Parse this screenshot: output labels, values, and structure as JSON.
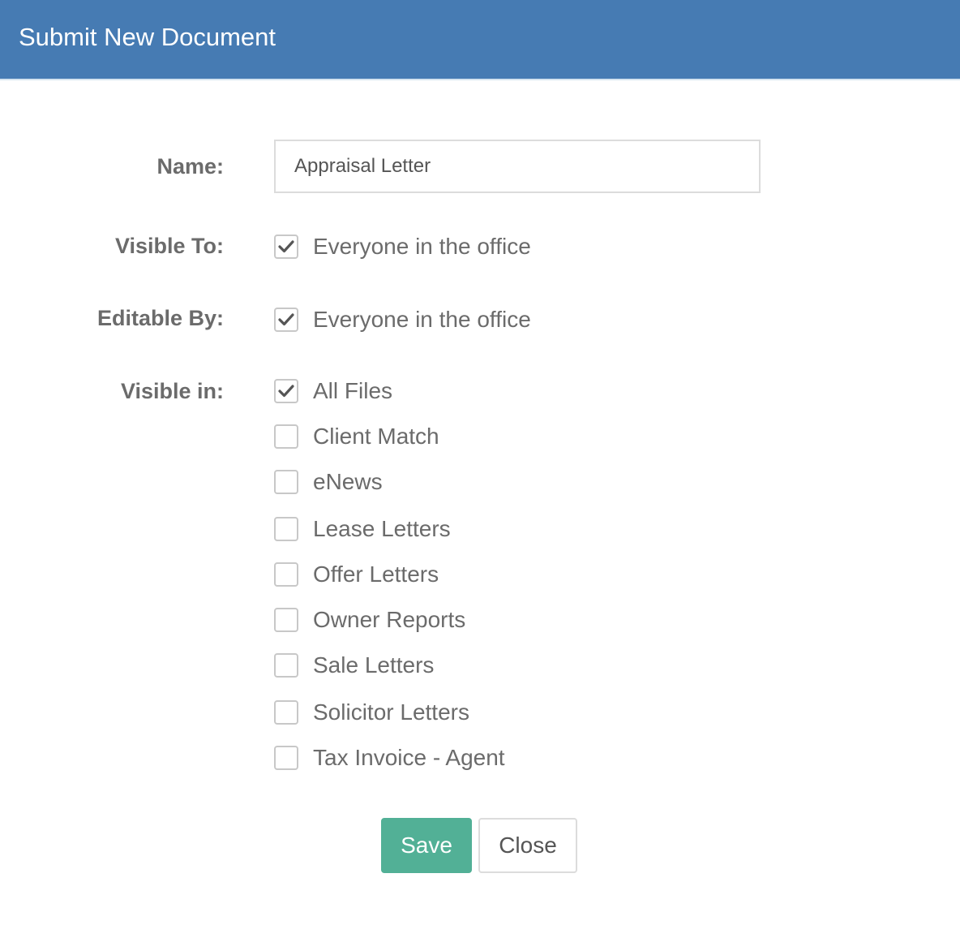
{
  "dialog": {
    "title": "Submit New Document"
  },
  "form": {
    "name_label": "Name:",
    "name_value": "Appraisal Letter",
    "visible_to_label": "Visible To:",
    "visible_to": {
      "label": "Everyone in the office",
      "checked": true
    },
    "editable_by_label": "Editable By:",
    "editable_by": {
      "label": "Everyone in the office",
      "checked": true
    },
    "visible_in_label": "Visible in:",
    "visible_in": [
      {
        "label": "All Files",
        "checked": true
      },
      {
        "label": "Client Match",
        "checked": false
      },
      {
        "label": "eNews",
        "checked": false
      },
      {
        "label": "Lease Letters",
        "checked": false
      },
      {
        "label": "Offer Letters",
        "checked": false
      },
      {
        "label": "Owner Reports",
        "checked": false
      },
      {
        "label": "Sale Letters",
        "checked": false
      },
      {
        "label": "Solicitor Letters",
        "checked": false
      },
      {
        "label": "Tax Invoice - Agent",
        "checked": false
      }
    ]
  },
  "actions": {
    "save_label": "Save",
    "close_label": "Close"
  },
  "colors": {
    "header": "#467bb3",
    "save_button": "#52b096",
    "label_text": "#6b6b6b"
  }
}
